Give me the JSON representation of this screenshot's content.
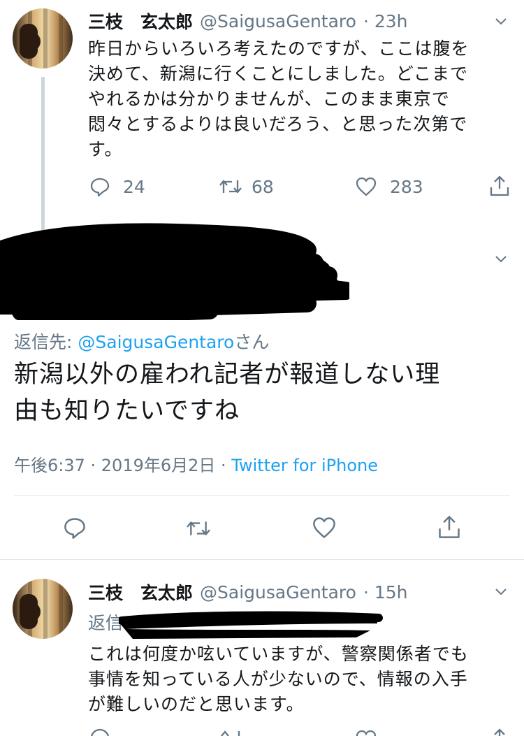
{
  "tweet1": {
    "name": "三枝　玄太郎",
    "handle": "@SaigusaGentaro",
    "time": "· 23h",
    "lines": [
      "昨日からいろいろ考えたのですが、ここは腹を",
      "決めて、新潟に行くことにしました。どこまで",
      "やれるかは分かりませんが、このまま東京で",
      "悶々とするよりは良いだろう、と思った次第で",
      "す。"
    ],
    "reply_count": "24",
    "retweet_count": "68",
    "like_count": "283"
  },
  "focused": {
    "reply_to_prefix": "返信先: ",
    "reply_to_handle": "@SaigusaGentaro",
    "reply_to_suffix": "さん",
    "lines": [
      "新潟以外の雇われ記者が報道しない理",
      "由も知りたいですね"
    ],
    "timestamp": "午後6:37 · 2019年6月2日 · ",
    "source": "Twitter for iPhone"
  },
  "tweet2": {
    "name": "三枝　玄太郎",
    "handle": "@SaigusaGentaro",
    "time": "· 15h",
    "reply_prefix": "返信",
    "lines": [
      "これは何度か呟いていますが、警察関係者でも",
      "事情を知っている人が少ないので、情報の入手",
      "が難しいのだと思います。"
    ]
  },
  "icons": {
    "reply": "reply-icon",
    "retweet": "retweet-icon",
    "like": "heart-icon",
    "share": "share-icon",
    "menu": "chevron-down-icon"
  },
  "colors": {
    "link": "#1da1f2",
    "muted": "#657786",
    "text": "#14171a",
    "divider": "#e1e8ed"
  }
}
